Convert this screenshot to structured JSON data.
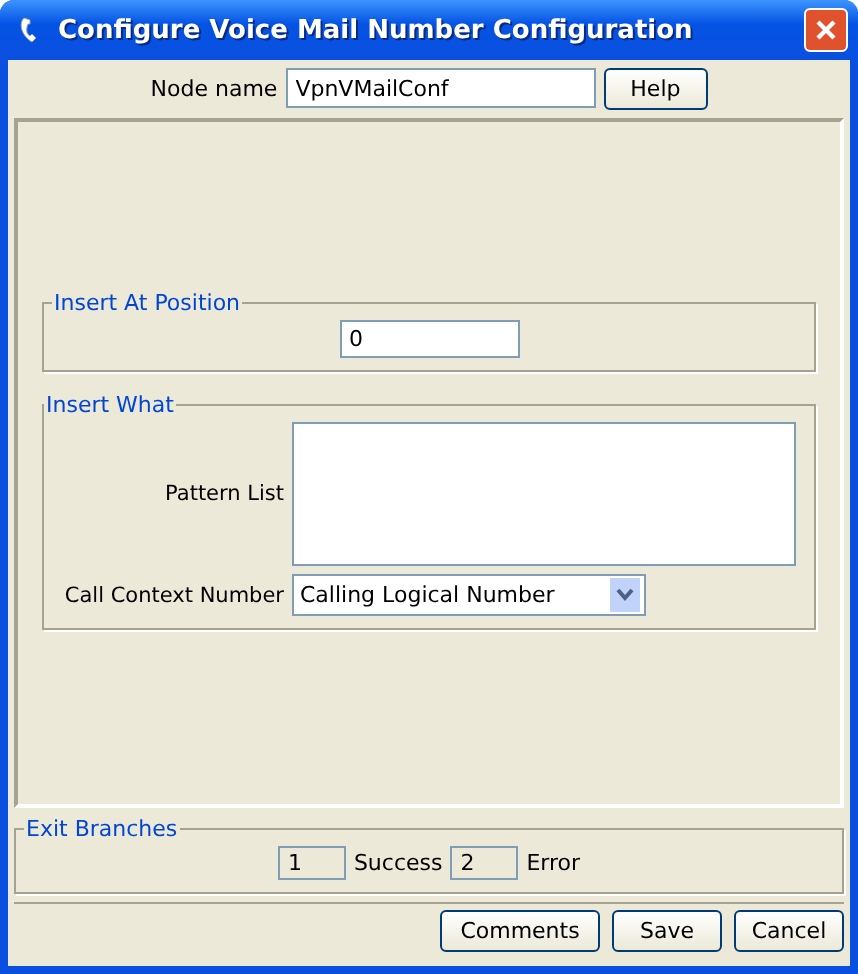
{
  "window": {
    "title": "Configure Voice Mail Number Configuration"
  },
  "node_name": {
    "label": "Node name",
    "value": "VpnVMailConf"
  },
  "help_button": "Help",
  "insert_at_position": {
    "legend": "Insert At Position",
    "value": "0"
  },
  "insert_what": {
    "legend": "Insert What",
    "pattern_list_label": "Pattern List",
    "call_context_label": "Call Context Number",
    "call_context_value": "Calling Logical Number"
  },
  "exit_branches": {
    "legend": "Exit Branches",
    "branches": [
      {
        "number": "1",
        "label": "Success"
      },
      {
        "number": "2",
        "label": "Error"
      }
    ]
  },
  "buttons": [
    "Comments",
    "Save",
    "Cancel"
  ]
}
